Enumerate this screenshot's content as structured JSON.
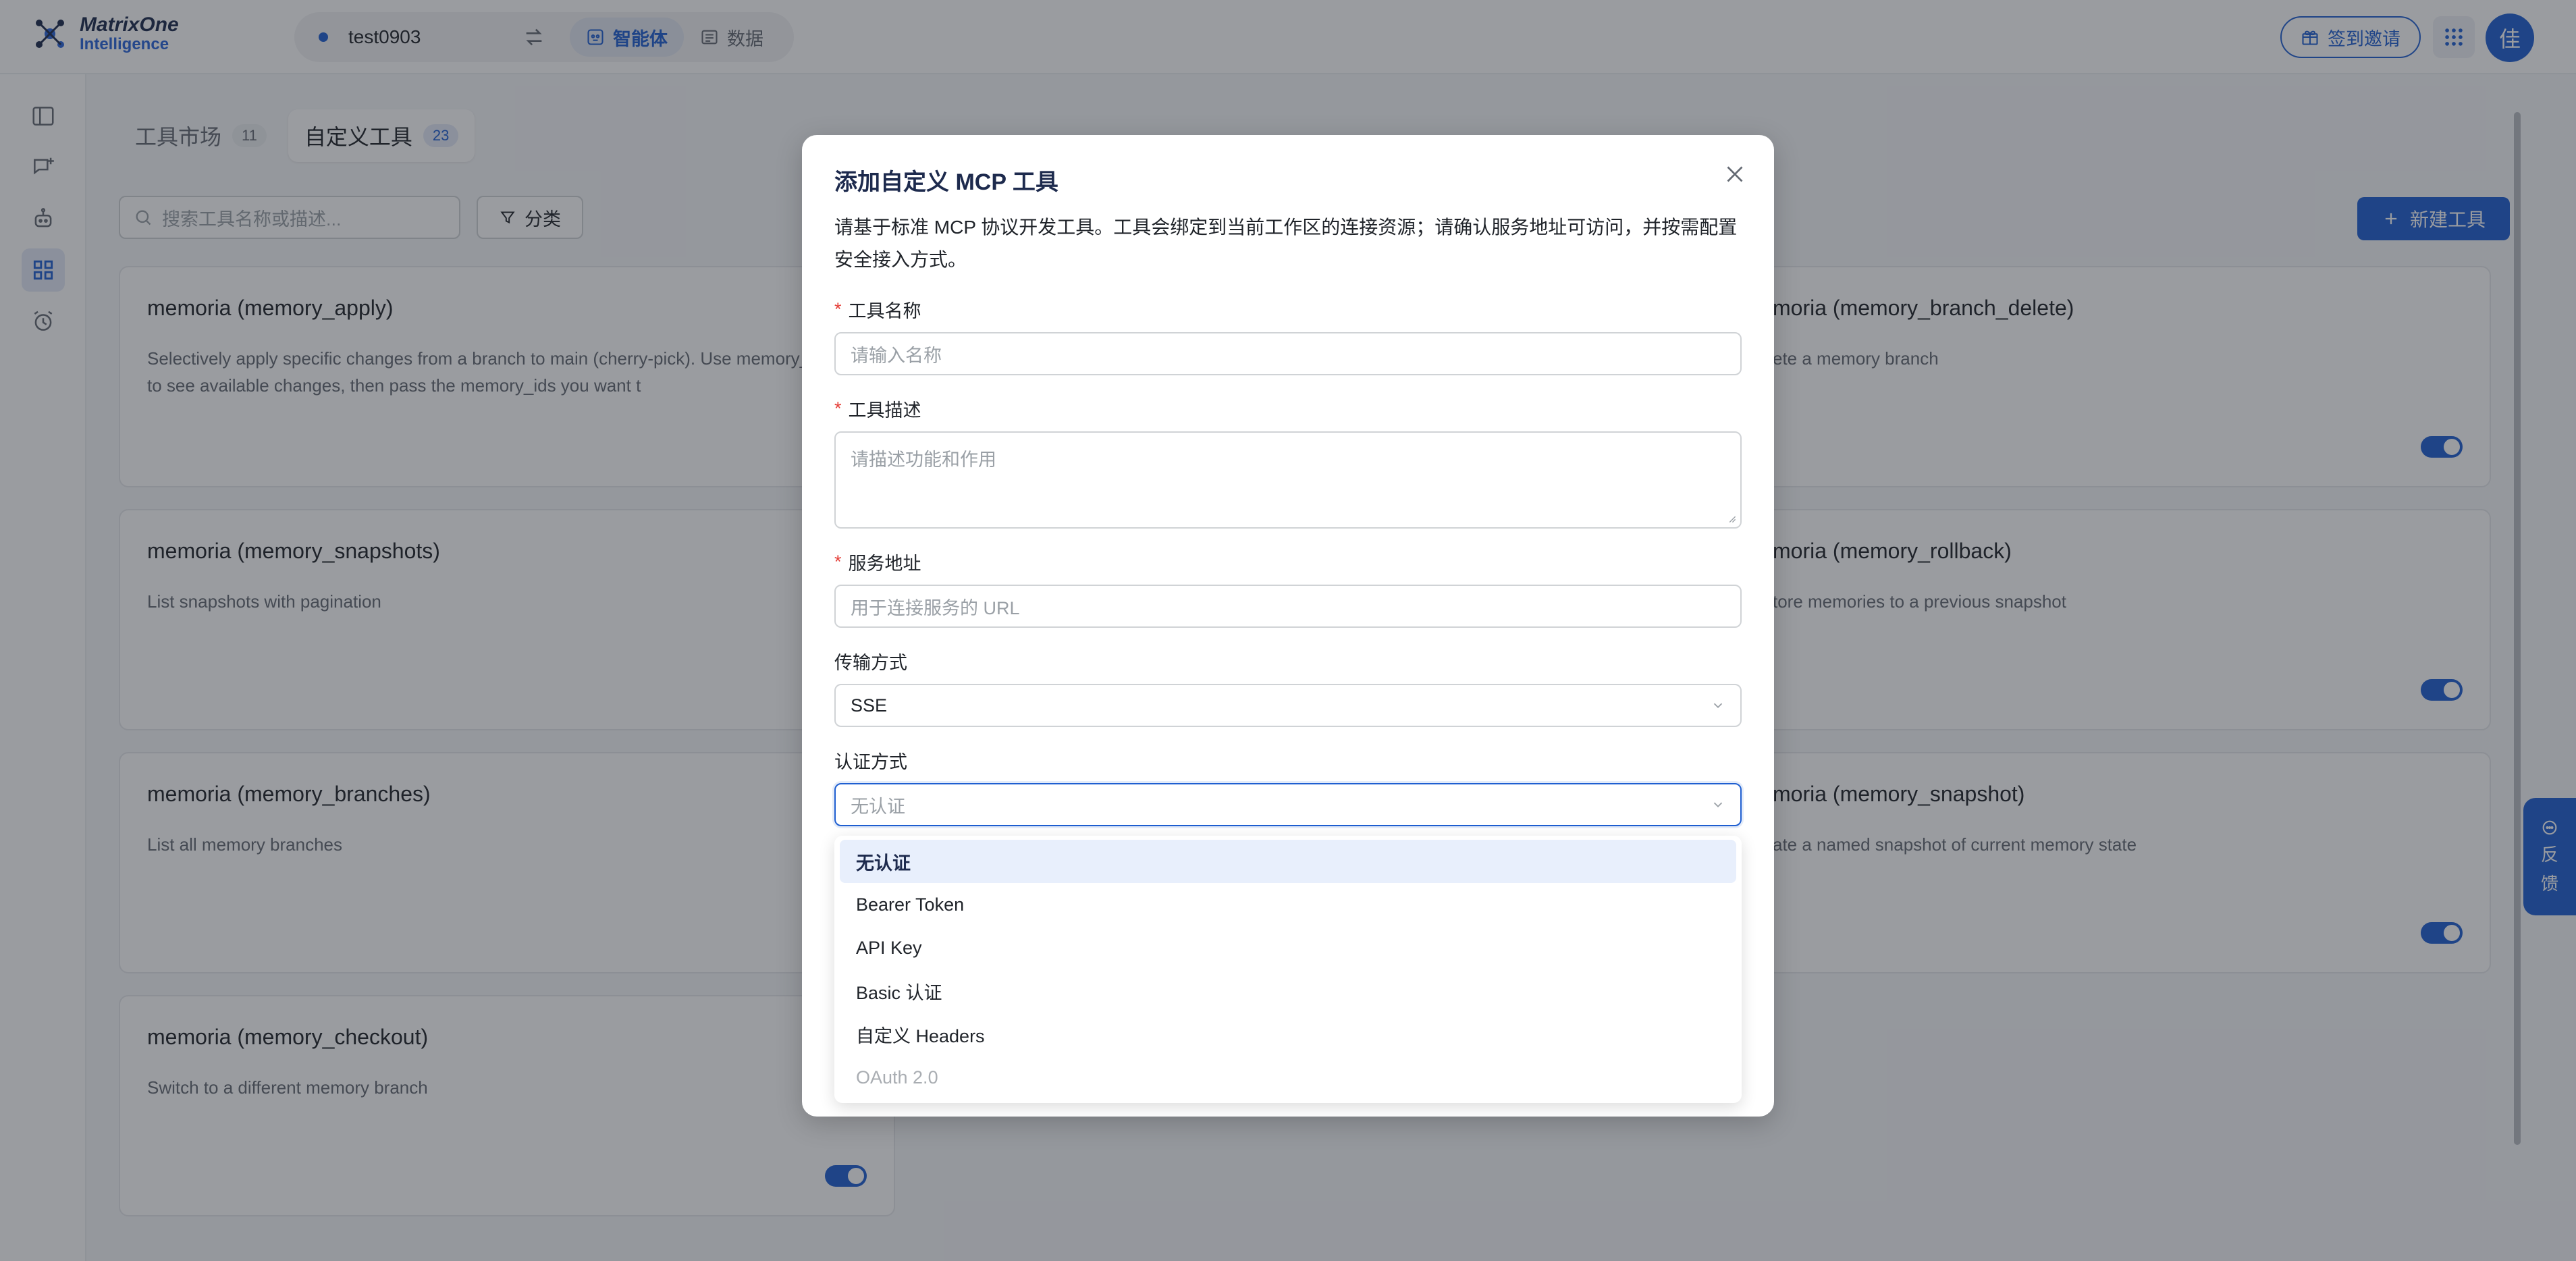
{
  "header": {
    "logo_line1": "MatrixOne",
    "logo_line2": "Intelligence",
    "workspace": "test0903",
    "nav_tabs": [
      {
        "label": "智能体"
      },
      {
        "label": "数据"
      }
    ],
    "invite_label": "签到邀请",
    "avatar_text": "佳"
  },
  "tabs": [
    {
      "label": "工具市场",
      "count": "11"
    },
    {
      "label": "自定义工具",
      "count": "23"
    }
  ],
  "search": {
    "placeholder": "搜索工具名称或描述..."
  },
  "filter_label": "分类",
  "new_tool_label": "新建工具",
  "cards": [
    {
      "title": "memoria (memory_apply)",
      "desc": "Selectively apply specific changes from a branch to main (cherry-pick). Use memory_diff first to see available changes, then pass the memory_ids you want t"
    },
    {
      "title": "moria (memory_branch_delete)",
      "desc": "ete a memory branch"
    },
    {
      "title": "memoria (memory_snapshots)",
      "desc": "List snapshots with pagination"
    },
    {
      "title": "moria (memory_rollback)",
      "desc": "tore memories to a previous snapshot"
    },
    {
      "title": "memoria (memory_branches)",
      "desc": "List all memory branches"
    },
    {
      "title": "moria (memory_snapshot)",
      "desc": "ate a named snapshot of current memory state"
    },
    {
      "title": "memoria (memory_checkout)",
      "desc": "Switch to a different memory branch"
    }
  ],
  "feedback": {
    "line1": "反",
    "line2": "馈"
  },
  "modal": {
    "title": "添加自定义 MCP 工具",
    "desc": "请基于标准 MCP 协议开发工具。工具会绑定到当前工作区的连接资源；请确认服务地址可访问，并按需配置安全接入方式。",
    "fields": {
      "name": {
        "label": "工具名称",
        "placeholder": "请输入名称"
      },
      "description": {
        "label": "工具描述",
        "placeholder": "请描述功能和作用"
      },
      "url": {
        "label": "服务地址",
        "placeholder": "用于连接服务的 URL"
      },
      "transport": {
        "label": "传输方式",
        "value": "SSE"
      },
      "auth": {
        "label": "认证方式",
        "value": "无认证"
      }
    },
    "auth_options": [
      "无认证",
      "Bearer Token",
      "API Key",
      "Basic 认证",
      "自定义 Headers",
      "OAuth 2.0"
    ]
  },
  "colors": {
    "accent": "#1f5fd1",
    "required": "#e5403a"
  }
}
